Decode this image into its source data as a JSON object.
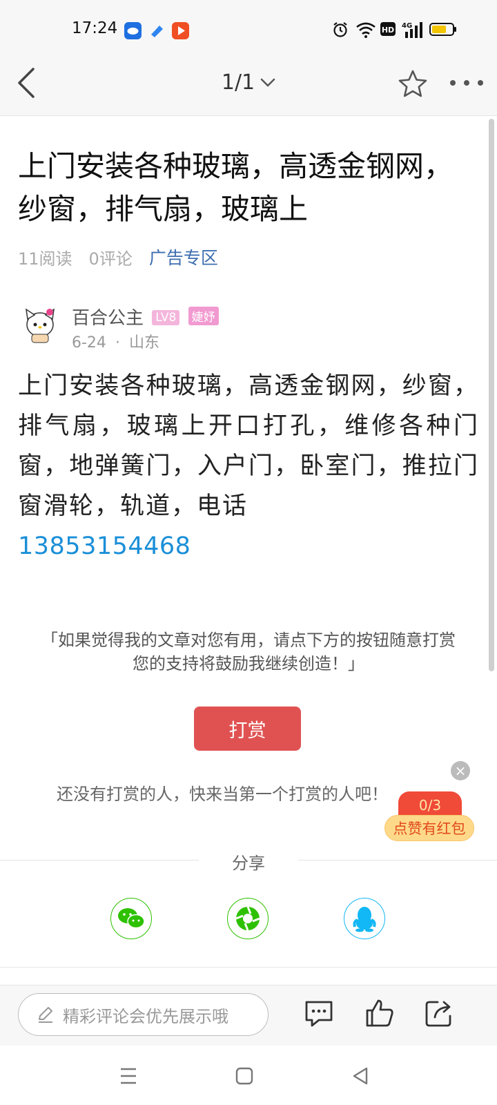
{
  "status_bar": {
    "time": "17:24",
    "apps": [
      "messaging-app-icon",
      "blue-app-icon",
      "video-app-icon"
    ],
    "right_icons": [
      "alarm-icon",
      "wifi-icon",
      "hd-icon",
      "signal-4g-icon",
      "battery-icon"
    ],
    "network": "4G",
    "hd": "HD"
  },
  "nav": {
    "page_indicator": "1/1"
  },
  "article": {
    "title": "上门安装各种玻璃，高透金钢网，纱窗，排气扇，玻璃上",
    "reads": "11阅读",
    "comments": "0评论",
    "category": "广告专区",
    "author": {
      "name": "百合公主",
      "level": "LV8",
      "title_badge": "婕妤",
      "date": "6-24",
      "separator": "·",
      "location": "山东"
    },
    "body_text": "上门安装各种玻璃，高透金钢网，纱窗，排气扇，玻璃上开口打孔，维修各种门窗，地弹簧门，入户门，卧室门，推拉门窗滑轮，轨道，电话",
    "phone": "13853154468"
  },
  "reward": {
    "note_line1": "「如果觉得我的文章对您有用，请点下方的按钮随意打赏",
    "note_line2": "您的支持将鼓励我继续创造！」",
    "button_label": "打赏",
    "empty_text": "还没有打赏的人，快来当第一个打赏的人吧！"
  },
  "promo": {
    "close": "×",
    "counter": "0/3",
    "label": "点赞有红包"
  },
  "share": {
    "label": "分享",
    "targets": [
      "wechat-icon",
      "moments-icon",
      "qq-icon"
    ]
  },
  "comment_bar": {
    "placeholder": "精彩评论会优先展示哦"
  },
  "colors": {
    "accent_red": "#e05252",
    "link_blue": "#3d6db0",
    "phone_blue": "#1a8fd8",
    "wechat_green": "#2dc100",
    "qq_blue": "#12b7f5"
  }
}
